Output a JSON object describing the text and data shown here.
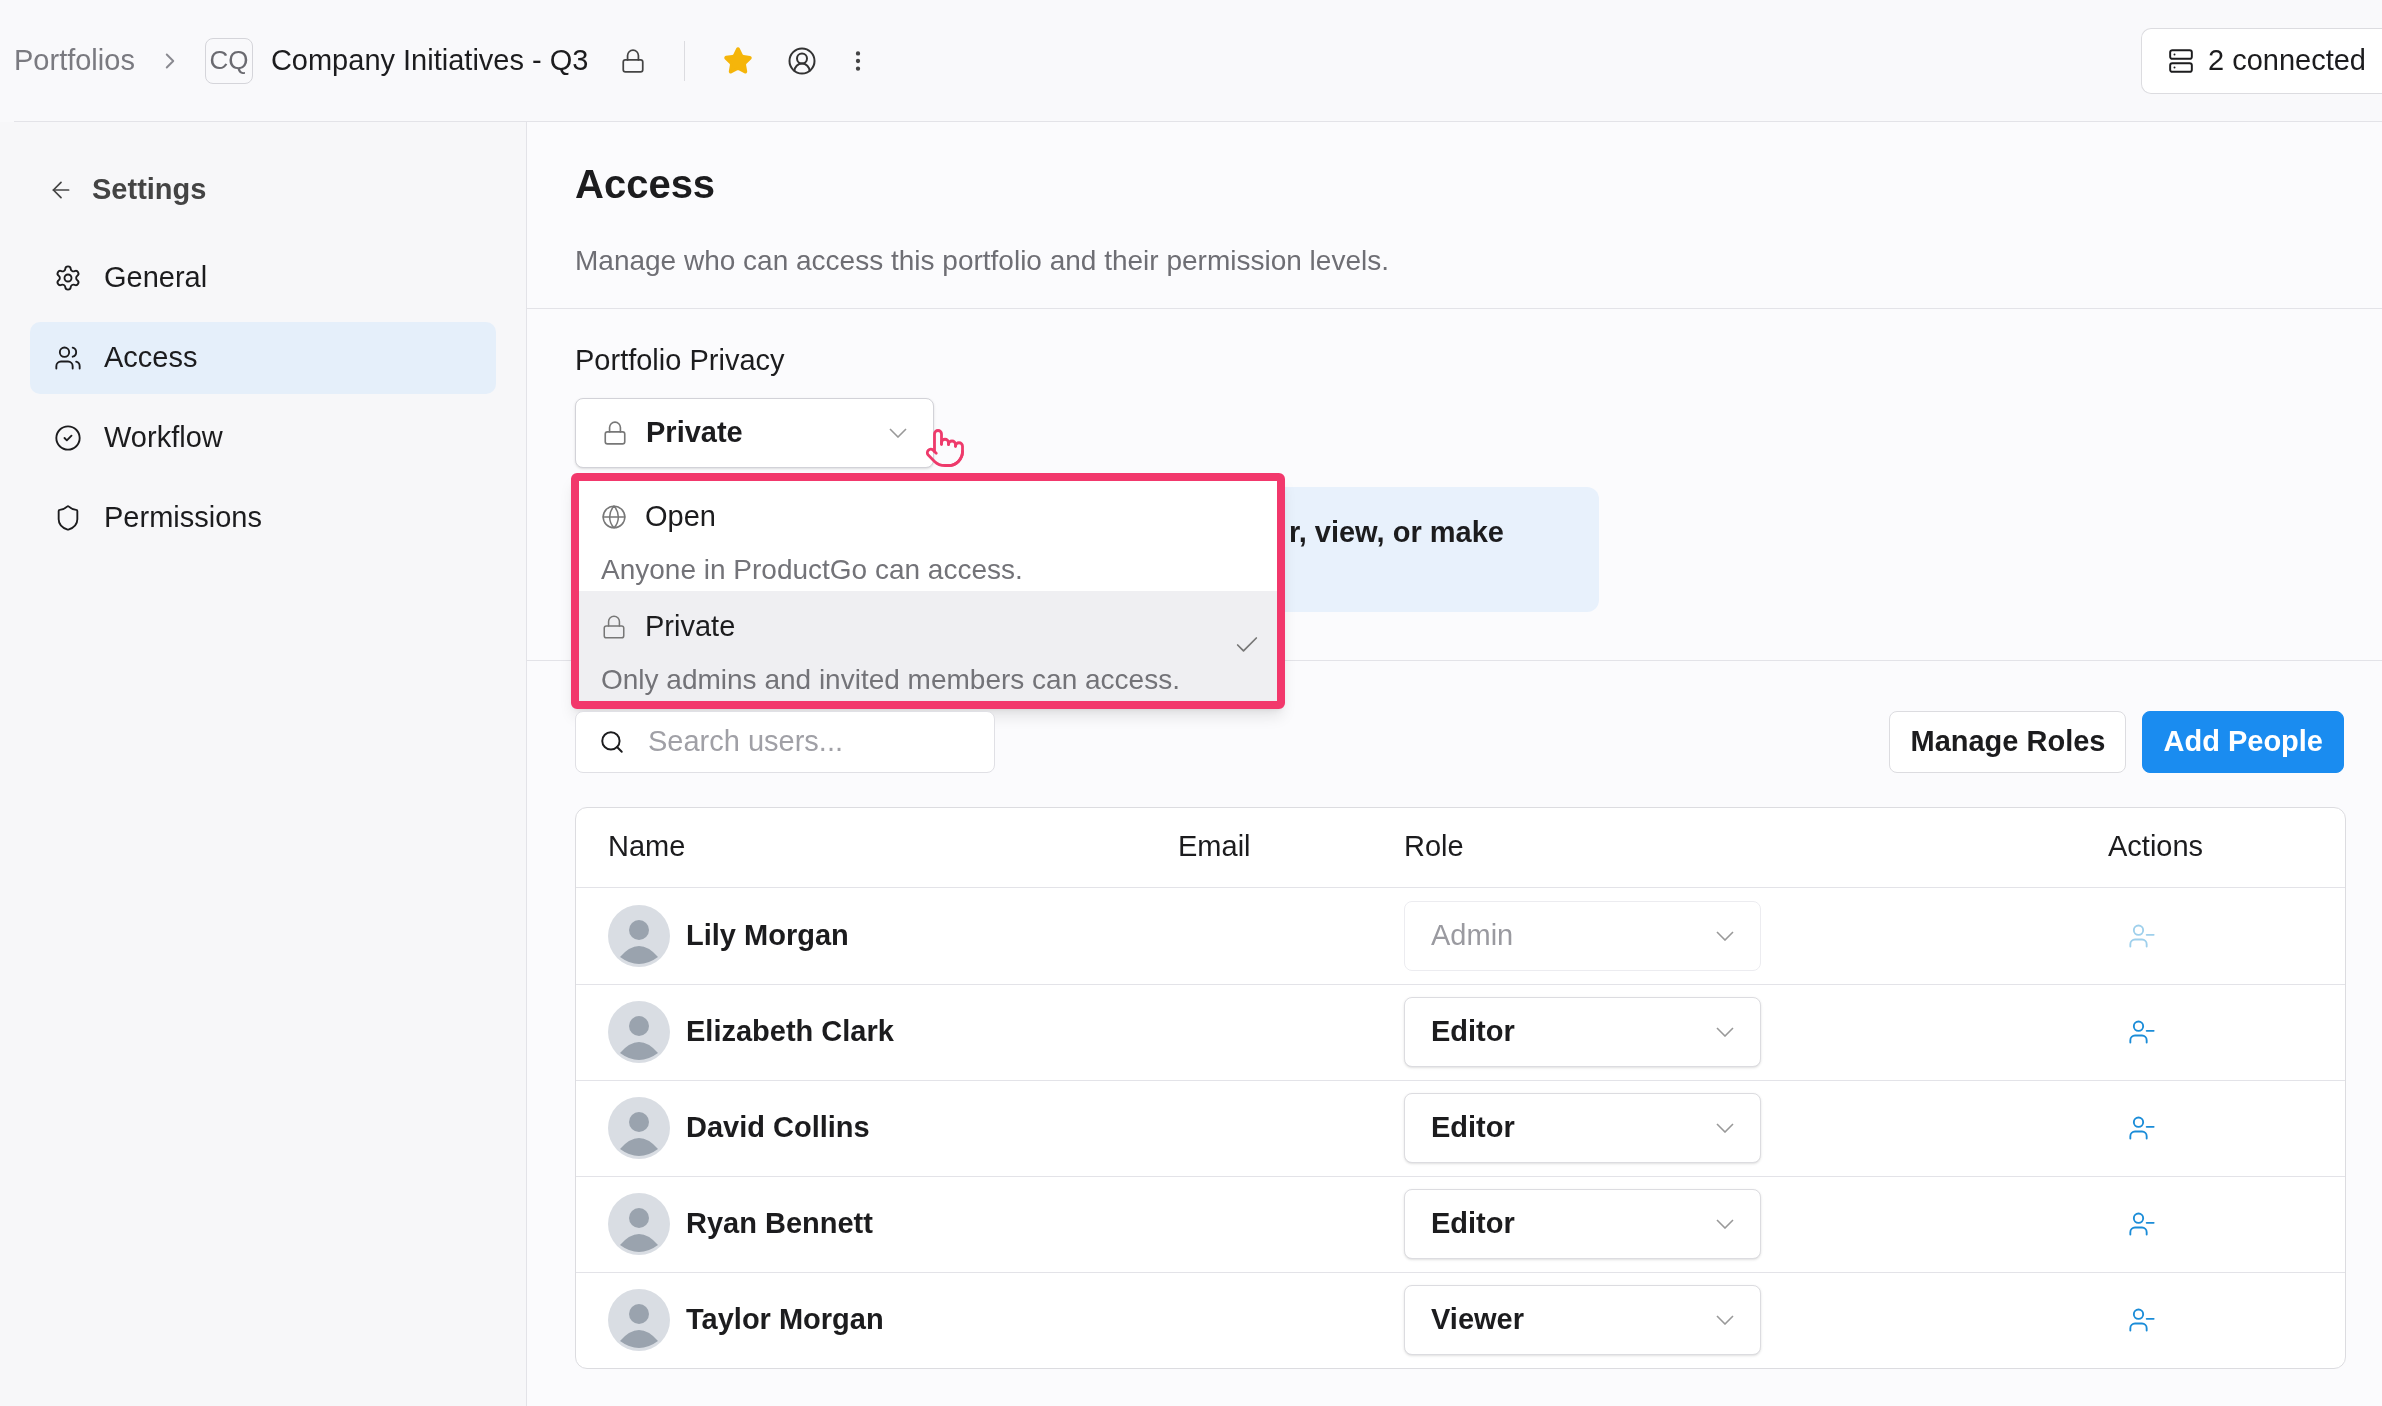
{
  "breadcrumb": {
    "root": "Portfolios",
    "badge": "CQ",
    "title": "Company Initiatives - Q3",
    "starred": true
  },
  "connected": "2 connected",
  "sidebar": {
    "back": "Settings",
    "items": [
      {
        "label": "General",
        "selected": false
      },
      {
        "label": "Access",
        "selected": true
      },
      {
        "label": "Workflow",
        "selected": false
      },
      {
        "label": "Permissions",
        "selected": false
      }
    ]
  },
  "page": {
    "title": "Access",
    "subtitle": "Manage who can access this portfolio and their permission levels."
  },
  "privacy": {
    "label": "Portfolio Privacy",
    "value": "Private",
    "expanded": true,
    "options": [
      {
        "label": "Open",
        "description": "Anyone in ProductGo can access.",
        "selected": false
      },
      {
        "label": "Private",
        "description": "Only admins and invited members can access.",
        "selected": true
      }
    ]
  },
  "info_text": "r, view, or make",
  "search": {
    "placeholder": "Search users..."
  },
  "buttons": [
    {
      "label": "Manage Roles",
      "kind": "secondary"
    },
    {
      "label": "Add People",
      "kind": "primary"
    }
  ],
  "table": {
    "columns": [
      "Name",
      "Email",
      "Role",
      "Actions"
    ],
    "rows": [
      {
        "name": "Lily Morgan",
        "role": "Admin",
        "disabled": true
      },
      {
        "name": "Elizabeth Clark",
        "role": "Editor",
        "disabled": false
      },
      {
        "name": "David Collins",
        "role": "Editor",
        "disabled": false
      },
      {
        "name": "Ryan Bennett",
        "role": "Editor",
        "disabled": false
      },
      {
        "name": "Taylor Morgan",
        "role": "Viewer",
        "disabled": false
      }
    ]
  }
}
